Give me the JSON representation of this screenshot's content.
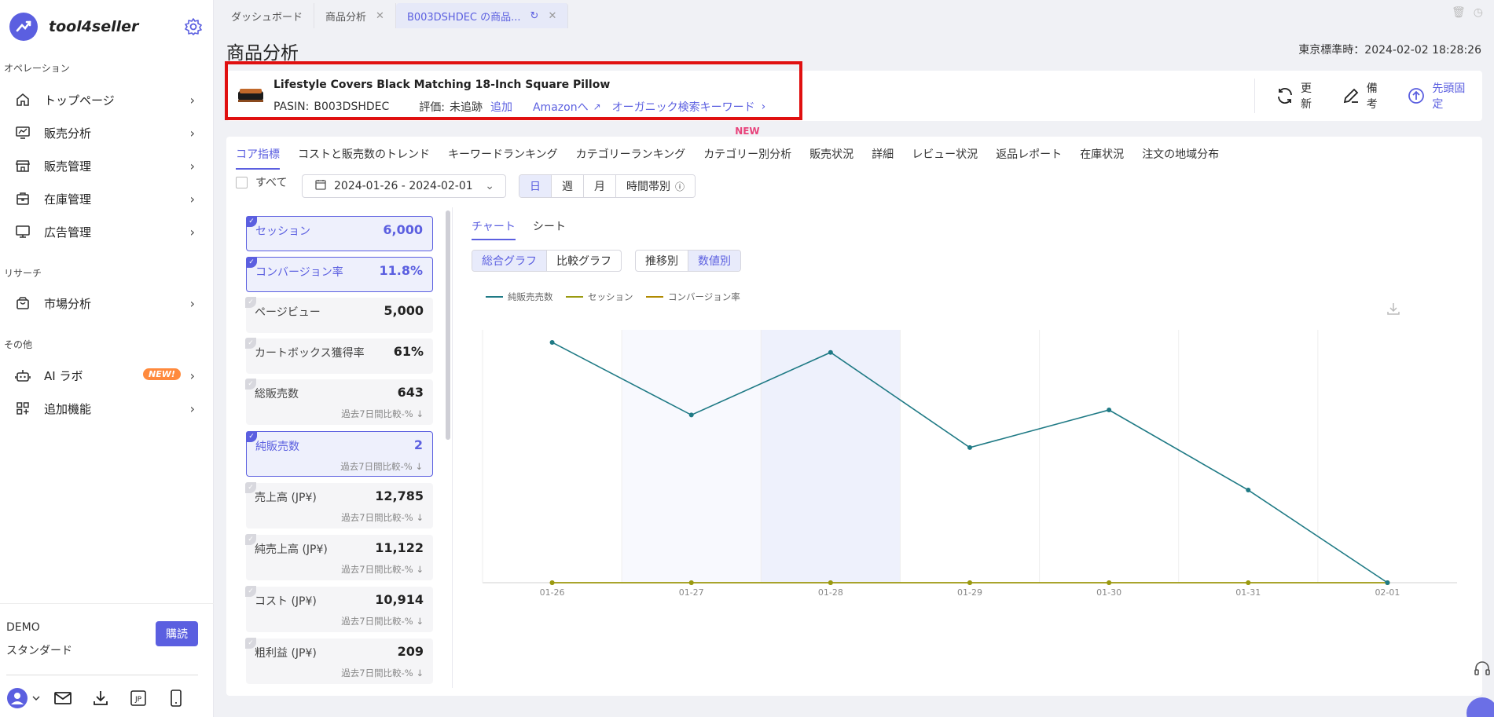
{
  "brand": {
    "name": "tool4seller"
  },
  "sidebar": {
    "sections": [
      {
        "label": "オペレーション"
      },
      {
        "label": "リサーチ"
      },
      {
        "label": "その他"
      }
    ],
    "items": [
      {
        "label": "トップページ",
        "icon": "home-icon"
      },
      {
        "label": "販売分析",
        "icon": "analytics-icon"
      },
      {
        "label": "販売管理",
        "icon": "store-icon"
      },
      {
        "label": "在庫管理",
        "icon": "inventory-icon"
      },
      {
        "label": "広告管理",
        "icon": "monitor-icon"
      },
      {
        "label": "市場分析",
        "icon": "bag-icon"
      },
      {
        "label": "AI ラボ",
        "icon": "robot-icon",
        "badge": "NEW!"
      },
      {
        "label": "追加機能",
        "icon": "apps-icon"
      }
    ],
    "account": {
      "name": "DEMO",
      "plan": "スタンダード",
      "subscribe_label": "購読"
    },
    "bottom_icons": [
      "user-icon",
      "mail-icon",
      "download-icon",
      "jp-icon",
      "phone-icon"
    ],
    "jp_label": "JP"
  },
  "tabs": [
    {
      "label": "ダッシュボード"
    },
    {
      "label": "商品分析"
    },
    {
      "label": "B003DSHDEC の商品..."
    }
  ],
  "page": {
    "title": "商品分析",
    "clock": "東京標準時：2024-02-02 18:28:26"
  },
  "product": {
    "title": "Lifestyle Covers Black Matching 18-Inch Square Pillow",
    "pasin_label": "PASIN:",
    "pasin": "B003DSHDEC",
    "rating_label": "評価:",
    "rating_value": "未追跡",
    "add_label": "追加",
    "amazon_label": "Amazonへ",
    "organic_label": "オーガニック検索キーワード",
    "actions": {
      "refresh": "更新",
      "note": "備考",
      "pin": "先頭固定"
    }
  },
  "subtabs": [
    {
      "label": "コア指標"
    },
    {
      "label": "コストと販売数のトレンド"
    },
    {
      "label": "キーワードランキング"
    },
    {
      "label": "カテゴリーランキング"
    },
    {
      "label": "カテゴリー別分析",
      "tag": "NEW"
    },
    {
      "label": "販売状況"
    },
    {
      "label": "詳細"
    },
    {
      "label": "レビュー状況"
    },
    {
      "label": "返品レポート"
    },
    {
      "label": "在庫状況"
    },
    {
      "label": "注文の地域分布"
    }
  ],
  "filters": {
    "all_label": "すべて",
    "date_range": "2024-01-26 - 2024-02-01",
    "granularity": [
      "日",
      "週",
      "月",
      "時間帯別"
    ],
    "granularity_selected": "日"
  },
  "metrics": [
    {
      "label": "セッション",
      "value": "6,000",
      "selected": true
    },
    {
      "label": "コンバージョン率",
      "value": "11.8%",
      "selected": true
    },
    {
      "label": "ページビュー",
      "value": "5,000",
      "selected": false
    },
    {
      "label": "カートボックス獲得率",
      "value": "61%",
      "selected": false
    },
    {
      "label": "総販売数",
      "value": "643",
      "sub": "過去7日間比較-%",
      "selected": false
    },
    {
      "label": "純販売数",
      "value": "2",
      "sub": "過去7日間比較-%",
      "selected": true
    },
    {
      "label": "売上高 (JP¥)",
      "value": "12,785",
      "sub": "過去7日間比較-%",
      "selected": false
    },
    {
      "label": "純売上高 (JP¥)",
      "value": "11,122",
      "sub": "過去7日間比較-%",
      "selected": false
    },
    {
      "label": "コスト (JP¥)",
      "value": "10,914",
      "sub": "過去7日間比較-%",
      "selected": false
    },
    {
      "label": "粗利益 (JP¥)",
      "value": "209",
      "sub": "過去7日間比較-%",
      "selected": false
    }
  ],
  "chart_tabs": [
    "チャート",
    "シート"
  ],
  "chart_modes": [
    "総合グラフ",
    "比較グラフ"
  ],
  "chart_modes_selected": "総合グラフ",
  "chart_views": [
    "推移別",
    "数値別"
  ],
  "chart_views_selected": "数値別",
  "colors": {
    "accent": "#5b5fe0",
    "series1": "#1f7a85",
    "series2": "#9a9a10",
    "series3": "#b08a00"
  },
  "chart_data": {
    "type": "line",
    "x": [
      "01-26",
      "01-27",
      "01-28",
      "01-29",
      "01-30",
      "01-31",
      "02-01"
    ],
    "series": [
      {
        "name": "純販売売数",
        "values": [
          0.96,
          0.67,
          0.92,
          0.54,
          0.69,
          0.37,
          0.0
        ]
      },
      {
        "name": "セッション",
        "values": [
          0,
          0,
          0,
          0,
          0,
          0,
          0
        ]
      },
      {
        "name": "コンバージョン率",
        "values": [
          0,
          0,
          0,
          0,
          0,
          0,
          0
        ]
      }
    ],
    "legend_position": "top-left",
    "grid": true
  }
}
